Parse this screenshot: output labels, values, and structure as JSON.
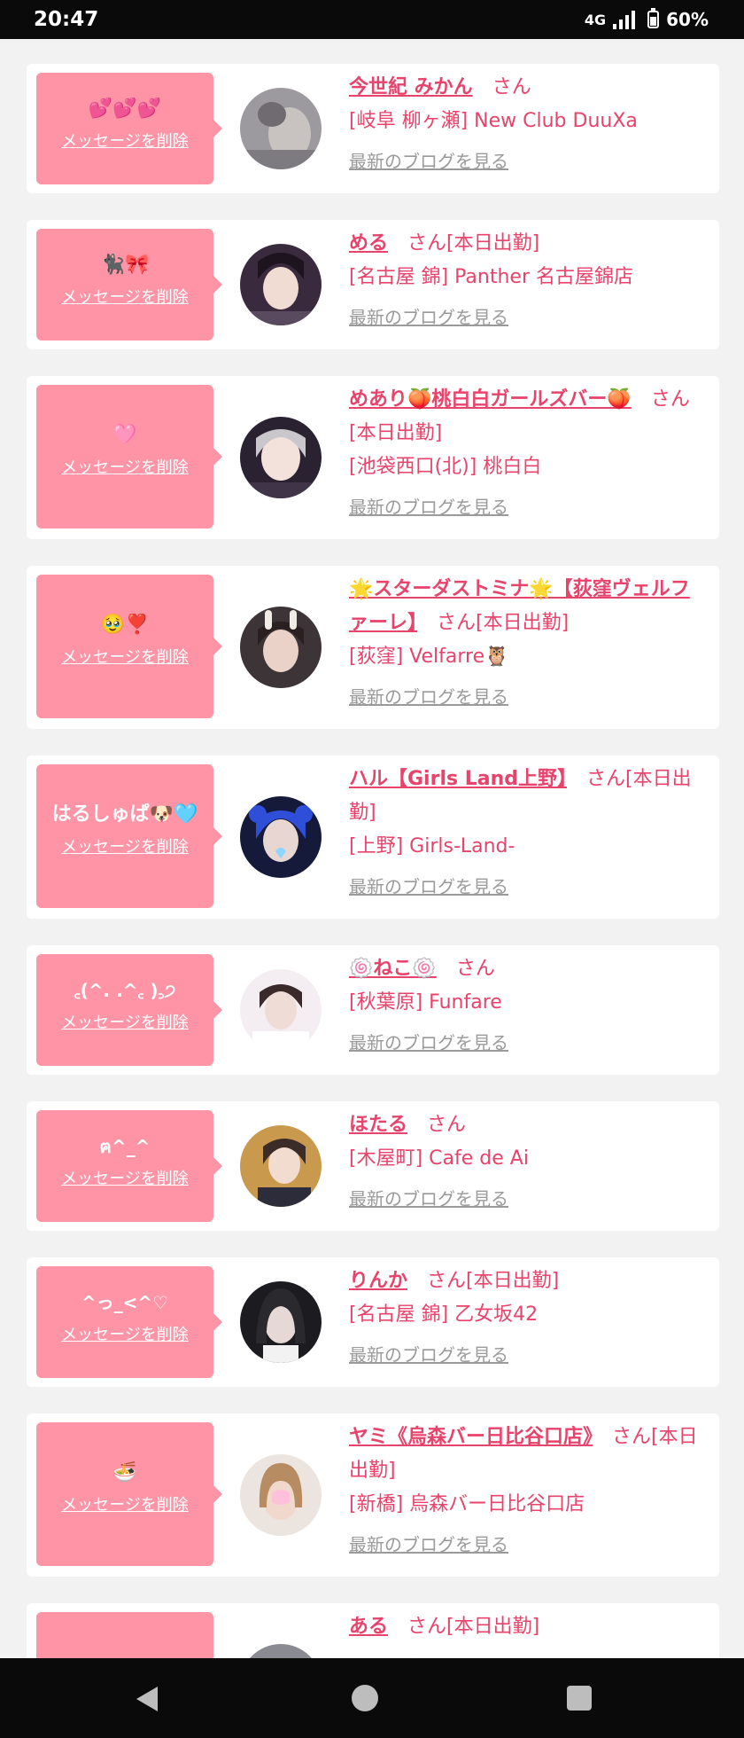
{
  "status": {
    "time": "20:47",
    "network": "4G",
    "battery": "60%"
  },
  "delete_label": "メッセージを削除",
  "blog_label": "最新のブログを見る",
  "colors": {
    "accent": "#e8436b",
    "message_box": "#ff94a6",
    "blog_link": "#9a9a9a"
  },
  "entries": [
    {
      "message": "💕💕💕",
      "name": "今世紀 みかん",
      "suffix": "さん",
      "shop": "[岐阜 柳ヶ瀬] New Club DuuXa"
    },
    {
      "message": "🐈‍⬛🎀",
      "name": "める",
      "suffix": "さん[本日出勤]",
      "shop": "[名古屋 錦] Panther 名古屋錦店"
    },
    {
      "message": "🩷",
      "name": "めあり🍑桃白白ガールズバー🍑",
      "suffix": "さん[本日出勤]",
      "shop": "[池袋西口(北)] 桃白白"
    },
    {
      "message": "🥹❣️",
      "name": "🌟スターダストミナ🌟【荻窪ヴェルファーレ】",
      "suffix": "さん[本日出勤]",
      "shop": "[荻窪] Velfarre🦉"
    },
    {
      "message": "はるしゅぱ🐶🩵",
      "name": "ハル【Girls Land上野】",
      "suffix": "さん[本日出勤]",
      "shop": "[上野] Girls-Land-"
    },
    {
      "message": "꜀(^. .^꜀ )꜆੭",
      "name": "🍥ねこ🍥",
      "suffix": "さん",
      "shop": "[秋葉原] Funfare"
    },
    {
      "message": "ฅ^_^",
      "name": "ほたる",
      "suffix": "さん",
      "shop": "[木屋町] Cafe de Ai"
    },
    {
      "message": "^っ_<^♡",
      "name": "りんか",
      "suffix": "さん[本日出勤]",
      "shop": "[名古屋 錦] 乙女坂42"
    },
    {
      "message": "🍜",
      "name": "ヤミ《烏森バー日比谷口店》",
      "suffix": "さん[本日出勤]",
      "shop": "[新橋] 烏森バー日比谷口店"
    },
    {
      "message": "",
      "name": "ある",
      "suffix": "さん[本日出勤]",
      "shop": ""
    }
  ]
}
